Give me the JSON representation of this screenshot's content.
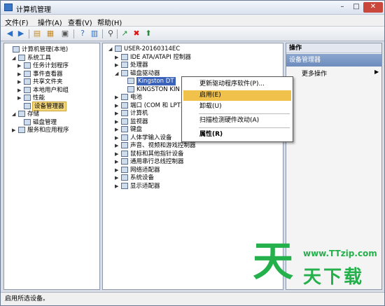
{
  "window": {
    "title": "计算机管理",
    "close": "✕",
    "min": "–",
    "max": "□"
  },
  "menu": [
    "文件(F)",
    "操作(A)",
    "查看(V)",
    "帮助(H)"
  ],
  "left_tree": [
    {
      "label": "计算机管理(本地)",
      "exp": "",
      "level": 0
    },
    {
      "label": "系统工具",
      "exp": "◢",
      "level": 1
    },
    {
      "label": "任务计划程序",
      "exp": "▶",
      "level": 2
    },
    {
      "label": "事件查看器",
      "exp": "▶",
      "level": 2
    },
    {
      "label": "共享文件夹",
      "exp": "▶",
      "level": 2
    },
    {
      "label": "本地用户和组",
      "exp": "▶",
      "level": 2
    },
    {
      "label": "性能",
      "exp": "▶",
      "level": 2
    },
    {
      "label": "设备管理器",
      "exp": "",
      "level": 2
    },
    {
      "label": "存储",
      "exp": "◢",
      "level": 1
    },
    {
      "label": "磁盘管理",
      "exp": "",
      "level": 2
    },
    {
      "label": "服务和应用程序",
      "exp": "▶",
      "level": 1
    }
  ],
  "device_tree": [
    {
      "label": "USER-20160314EC",
      "exp": "◢",
      "level": 0
    },
    {
      "label": "IDE ATA/ATAPI 控制器",
      "exp": "▶",
      "level": 1
    },
    {
      "label": "处理器",
      "exp": "▶",
      "level": 1
    },
    {
      "label": "磁盘驱动器",
      "exp": "◢",
      "level": 1
    },
    {
      "label": "Kingston DT",
      "exp": "",
      "level": 2
    },
    {
      "label": "KINGSTON KIN",
      "exp": "",
      "level": 2
    },
    {
      "label": "电池",
      "exp": "▶",
      "level": 1
    },
    {
      "label": "端口 (COM 和 LPT)",
      "exp": "▶",
      "level": 1
    },
    {
      "label": "计算机",
      "exp": "▶",
      "level": 1
    },
    {
      "label": "监视器",
      "exp": "▶",
      "level": 1
    },
    {
      "label": "键盘",
      "exp": "▶",
      "level": 1
    },
    {
      "label": "人体学输入设备",
      "exp": "▶",
      "level": 1
    },
    {
      "label": "声音、视频和游戏控制器",
      "exp": "▶",
      "level": 1
    },
    {
      "label": "鼠标和其他指针设备",
      "exp": "▶",
      "level": 1
    },
    {
      "label": "通用串行总线控制器",
      "exp": "▶",
      "level": 1
    },
    {
      "label": "网络适配器",
      "exp": "▶",
      "level": 1
    },
    {
      "label": "系统设备",
      "exp": "▶",
      "level": 1
    },
    {
      "label": "显示适配器",
      "exp": "▶",
      "level": 1
    }
  ],
  "actions": {
    "header": "操作",
    "section": "设备管理器",
    "more": "更多操作",
    "more_arrow": "▶"
  },
  "context_menu": [
    "更新驱动程序软件(P)...",
    "启用(E)",
    "卸载(U)",
    "扫描检测硬件改动(A)",
    "属性(R)"
  ],
  "status": "启用所选设备。",
  "watermark": {
    "big": "天",
    "url": "www.TTzip.com",
    "text": "天下载"
  },
  "colors": {
    "accent": "#24b04a",
    "highlight": "#f0c24b"
  }
}
